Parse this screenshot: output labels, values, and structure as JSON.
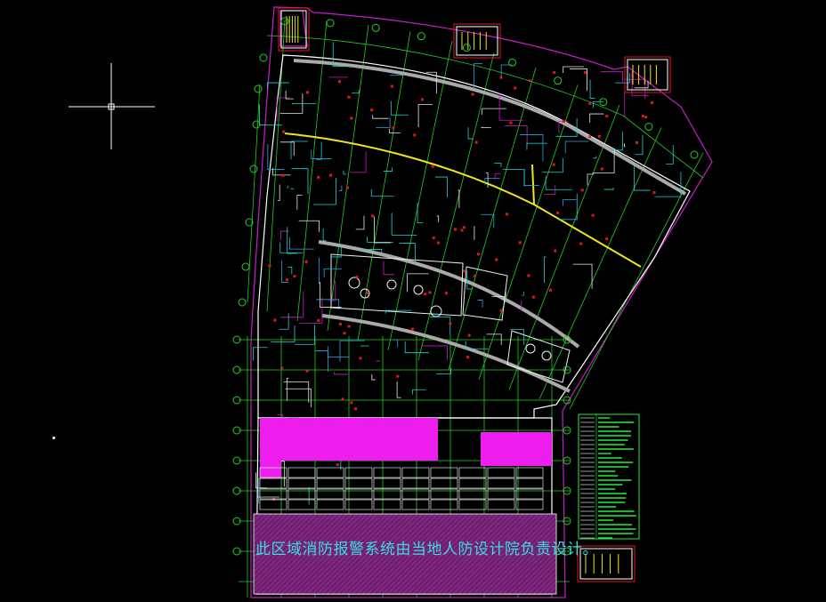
{
  "drawing": {
    "note_text": "此区域消防报警系统由当地人防设计院负责设计。",
    "colors": {
      "background": "#000000",
      "site_boundary": "#c81dc8",
      "axis_grid": "#1fd11f",
      "building_outline": "#ffffff",
      "walls": "#b5b5b5",
      "wiring_cyan": "#21d4d4",
      "wiring_white": "#e8e8e8",
      "main_trunk": "#f2e51a",
      "columns_red": "#e01818",
      "magenta_zone": "#ee1fee",
      "hatched_zone": "#9a2b9a",
      "legend_text": "#22ee44",
      "note_text": "#34e0e0"
    },
    "icons": {
      "crosshair": "cad-crosshair-cursor-icon",
      "ucs": "ucs-origin-dot-icon"
    }
  }
}
